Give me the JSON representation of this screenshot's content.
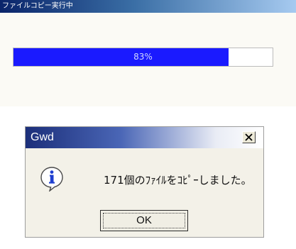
{
  "copy_window": {
    "title": "ファイルコピー実行中",
    "progress": {
      "value": 0.83,
      "text": "83%"
    }
  },
  "message_box": {
    "title": "Gwd",
    "message": "171個のﾌｧｲﾙをｺﾋﾟｰしました。",
    "ok_label": "OK",
    "close_glyph": "close-icon",
    "icon": "info-icon"
  },
  "colors": {
    "progress_fill": "#1a1aff",
    "title_gradient_dark": "#1c2f7a",
    "dialog_background": "#f3f1e8"
  }
}
